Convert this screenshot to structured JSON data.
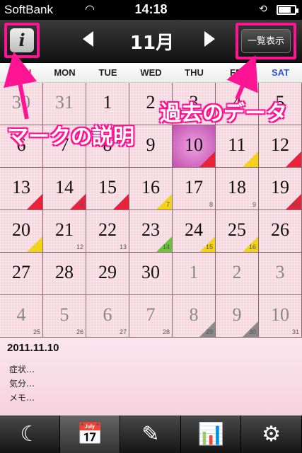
{
  "status": {
    "carrier": "SoftBank",
    "time": "14:18"
  },
  "nav": {
    "month": "11月",
    "list_button": "一覧表示",
    "info_icon": "i"
  },
  "weekdays": [
    "SUN",
    "MON",
    "TUE",
    "WED",
    "THU",
    "FRI",
    "SAT"
  ],
  "weekday_colors": {
    "sun": "#cc0000",
    "sat": "#3355cc"
  },
  "calendar": [
    [
      {
        "d": "30",
        "o": 1
      },
      {
        "d": "31",
        "o": 1
      },
      {
        "d": "1"
      },
      {
        "d": "2"
      },
      {
        "d": "3"
      },
      {
        "d": "4"
      },
      {
        "d": "5"
      }
    ],
    [
      {
        "d": "6"
      },
      {
        "d": "7"
      },
      {
        "d": "8"
      },
      {
        "d": "9"
      },
      {
        "d": "10",
        "today": 1,
        "mark": "red"
      },
      {
        "d": "11",
        "mark": "yellow"
      },
      {
        "d": "12",
        "mark": "red"
      }
    ],
    [
      {
        "d": "13",
        "mark": "red"
      },
      {
        "d": "14",
        "s": "6",
        "mark": "red"
      },
      {
        "d": "15",
        "mark": "red"
      },
      {
        "d": "16",
        "s": "7",
        "mark": "yellow"
      },
      {
        "d": "17",
        "s": "8"
      },
      {
        "d": "18",
        "s": "9"
      },
      {
        "d": "19",
        "s": "10",
        "mark": "red"
      }
    ],
    [
      {
        "d": "20",
        "mark": "yellow"
      },
      {
        "d": "21",
        "s": "12"
      },
      {
        "d": "22",
        "s": "13"
      },
      {
        "d": "23",
        "s": "14",
        "mark": "green"
      },
      {
        "d": "24",
        "s": "15",
        "mark": "yellow"
      },
      {
        "d": "25",
        "s": "16",
        "mark": "yellow"
      },
      {
        "d": "26"
      }
    ],
    [
      {
        "d": "27"
      },
      {
        "d": "28"
      },
      {
        "d": "29"
      },
      {
        "d": "30"
      },
      {
        "d": "1",
        "o": 1
      },
      {
        "d": "2",
        "o": 1
      },
      {
        "d": "3",
        "o": 1
      }
    ],
    [
      {
        "d": "4",
        "o": 1,
        "s": "25"
      },
      {
        "d": "5",
        "o": 1,
        "s": "26"
      },
      {
        "d": "6",
        "o": 1,
        "s": "27"
      },
      {
        "d": "7",
        "o": 1,
        "s": "28"
      },
      {
        "d": "8",
        "o": 1,
        "s": "29",
        "mark": "gray"
      },
      {
        "d": "9",
        "o": 1,
        "s": "30",
        "mark": "gray"
      },
      {
        "d": "10",
        "o": 1,
        "s": "31"
      }
    ]
  ],
  "mark_colors": {
    "red": "#e8223a",
    "yellow": "#f2d21a",
    "green": "#6cc23a",
    "gray": "#8a8a8a"
  },
  "callouts": {
    "past_data": "過去のデータ",
    "mark_explain": "マークの説明"
  },
  "memo": {
    "date": "2011.11.10",
    "symptom": "症状…",
    "mood": "気分…",
    "memo": "メモ…"
  },
  "tabs": [
    {
      "icon": "moon-star-icon",
      "glyph": "☾",
      "active": false
    },
    {
      "icon": "calendar-icon",
      "glyph": "📅",
      "active": true
    },
    {
      "icon": "notepad-pencil-icon",
      "glyph": "✎",
      "active": false
    },
    {
      "icon": "bar-chart-icon",
      "glyph": "📊",
      "active": false
    },
    {
      "icon": "settings-plant-icon",
      "glyph": "⚙",
      "active": false
    }
  ]
}
